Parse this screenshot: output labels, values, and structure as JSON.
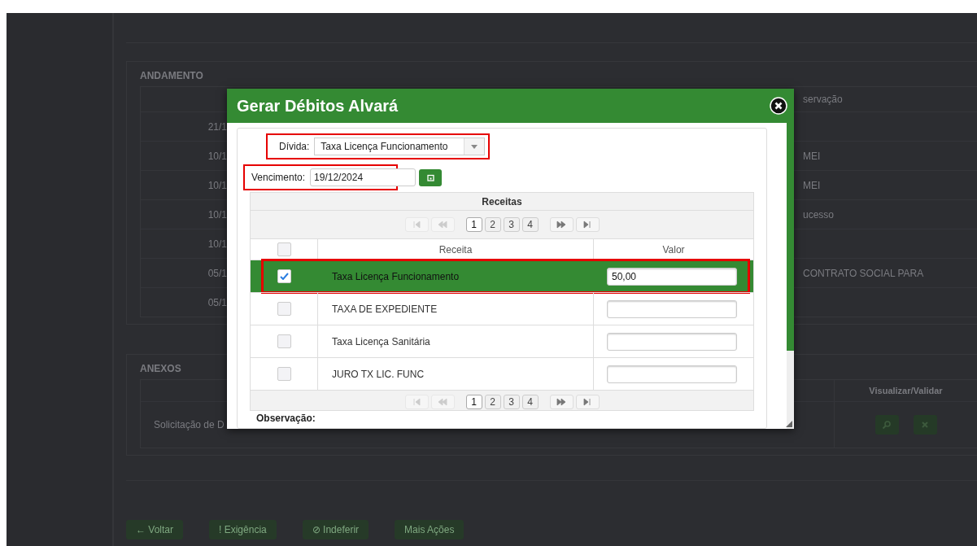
{
  "andamento": {
    "title": "ANDAMENTO",
    "column_3_header": "servação",
    "rows": [
      {
        "column_1": "21/1"
      },
      {
        "column_1": "10/1",
        "column_3": "MEI"
      },
      {
        "column_1": "10/1",
        "column_3": "MEI"
      },
      {
        "column_1": "10/1",
        "column_3": "ucesso"
      },
      {
        "column_1": "10/1"
      },
      {
        "column_1": "05/1",
        "column_3": "CONTRATO SOCIAL PARA"
      },
      {
        "column_1": "05/1"
      }
    ]
  },
  "anexos": {
    "title": "ANEXOS",
    "column_header": "Visualizar/Validar",
    "row_text": "Solicitação de D"
  },
  "actions": [
    {
      "icon": "←",
      "label": "Voltar"
    },
    {
      "icon": "!",
      "label": "Exigência"
    },
    {
      "icon": "⊘",
      "label": "Indeferir"
    },
    {
      "label": "Mais Ações"
    }
  ],
  "modal": {
    "title": "Gerar Débitos Alvará",
    "divida": {
      "label": "Dívida:",
      "value": "Taxa Licença Funcionamento",
      "highlighted": true
    },
    "vencimento": {
      "label": "Vencimento:",
      "value": "19/12/2024",
      "highlighted": true
    },
    "grid": {
      "caption": "Receitas",
      "pager_top": {
        "nav": [
          {
            "kind": "first",
            "disabled": true
          },
          {
            "kind": "prev",
            "disabled": true
          },
          {
            "kind": "next",
            "disabled": false
          },
          {
            "kind": "last",
            "disabled": false
          }
        ],
        "pages": [
          {
            "label": "1",
            "selected": true
          },
          {
            "label": "2",
            "selected": false
          },
          {
            "label": "3",
            "selected": false
          },
          {
            "label": "4",
            "selected": false
          }
        ]
      },
      "header_checked": false,
      "columns": [
        "Receita",
        "Valor"
      ],
      "rows": [
        {
          "checked": true,
          "selected": true,
          "highlighted": true,
          "receita": "Taxa Licença Funcionamento",
          "valor": "50,00"
        },
        {
          "checked": false,
          "selected": false,
          "highlighted": false,
          "receita": "TAXA DE EXPEDIENTE"
        },
        {
          "checked": false,
          "selected": false,
          "highlighted": false,
          "receita": "Taxa Licença Sanitária"
        },
        {
          "checked": false,
          "selected": false,
          "highlighted": false,
          "receita": "JURO TX LIC. FUNC"
        }
      ],
      "pager_bottom": {
        "nav": [
          {
            "kind": "first",
            "disabled": true
          },
          {
            "kind": "prev",
            "disabled": true
          },
          {
            "kind": "next",
            "disabled": false
          },
          {
            "kind": "last",
            "disabled": false
          }
        ],
        "pages": [
          {
            "label": "1",
            "selected": true
          },
          {
            "label": "2",
            "selected": false
          },
          {
            "label": "3",
            "selected": false
          },
          {
            "label": "4",
            "selected": false
          }
        ]
      }
    },
    "observacao_label": "Observação:"
  }
}
